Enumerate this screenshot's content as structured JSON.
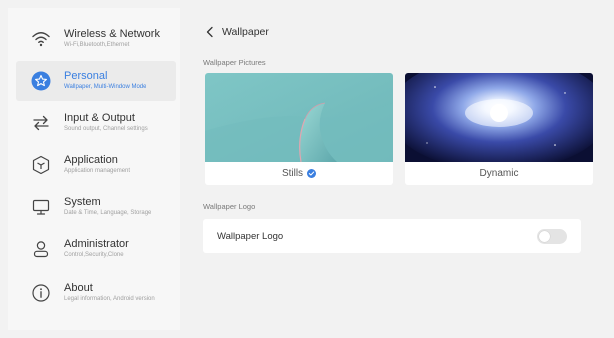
{
  "sidebar": {
    "items": [
      {
        "title": "Wireless & Network",
        "subtitle": "Wi-Fi,Bluetooth,Ethernet",
        "icon": "wifi-icon",
        "active": false
      },
      {
        "title": "Personal",
        "subtitle": "Wallpaper, Multi-Window Mode",
        "icon": "star-icon",
        "active": true
      },
      {
        "title": "Input & Output",
        "subtitle": "Sound output, Channel settings",
        "icon": "swap-arrows-icon",
        "active": false
      },
      {
        "title": "Application",
        "subtitle": "Application management",
        "icon": "cube-icon",
        "active": false
      },
      {
        "title": "System",
        "subtitle": "Date & Time, Language, Storage",
        "icon": "monitor-icon",
        "active": false
      },
      {
        "title": "Administrator",
        "subtitle": "Control,Security,Clone",
        "icon": "user-icon",
        "active": false
      },
      {
        "title": "About",
        "subtitle": "Legal information, Android version",
        "icon": "info-icon",
        "active": false
      }
    ]
  },
  "main": {
    "back_label": "Wallpaper",
    "pictures_section": "Wallpaper Pictures",
    "cards": [
      {
        "label": "Stills",
        "selected": true
      },
      {
        "label": "Dynamic",
        "selected": false
      }
    ],
    "logo_section": "Wallpaper Logo",
    "logo_row_label": "Wallpaper Logo",
    "logo_toggle_on": false
  },
  "colors": {
    "accent": "#3a7fe0",
    "stills_bg": "#7fc3c3",
    "dynamic_bg": "#0b0f33"
  }
}
